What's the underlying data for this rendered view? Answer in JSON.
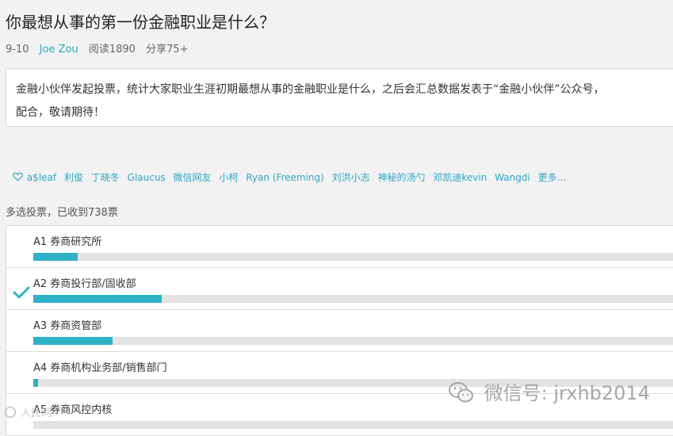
{
  "post": {
    "title": "你最想从事的第一份金融职业是什么？",
    "date": "9-10",
    "author": "Joe Zou",
    "reads": "阅读1890",
    "shares": "分享75+",
    "description_line1": "金融小伙伴发起投票，统计大家职业生涯初期最想从事的金融职业是什么，之后会汇总数据发表于“金融小伙伴”公众号，",
    "description_line2": "配合，敬请期待！"
  },
  "likes": {
    "icon": "heart-icon",
    "users": [
      "a$leaf",
      "利俊",
      "丁晓冬",
      "Glaucus",
      "微信网友",
      "小柯",
      "Ryan (Freeming)",
      "刘洪小志",
      "神秘的汤勺",
      "邓凯迪kevin",
      "Wangdi",
      "更多..."
    ]
  },
  "vote": {
    "info": "多选投票，已收到738票",
    "options": [
      {
        "label": "A1 券商研究所",
        "fraction": 0.067,
        "checked": false
      },
      {
        "label": "A2 券商投行部/固收部",
        "fraction": 0.195,
        "checked": true
      },
      {
        "label": "A3 券商资管部",
        "fraction": 0.12,
        "checked": false
      },
      {
        "label": "A4 券商机构业务部/销售部门",
        "fraction": 0.007,
        "checked": false
      },
      {
        "label": "A5 券商风控内核",
        "fraction": 0.0,
        "checked": false
      }
    ]
  },
  "watermark": {
    "text": "微信号: jrxhb2014",
    "icon": "wechat-logo"
  },
  "corner_logo": {
    "text": "人民网",
    "icon": "ie-logo"
  },
  "colors": {
    "accent": "#2fb1c8",
    "link": "#2fa7c5",
    "track": "#e3e3e3"
  }
}
